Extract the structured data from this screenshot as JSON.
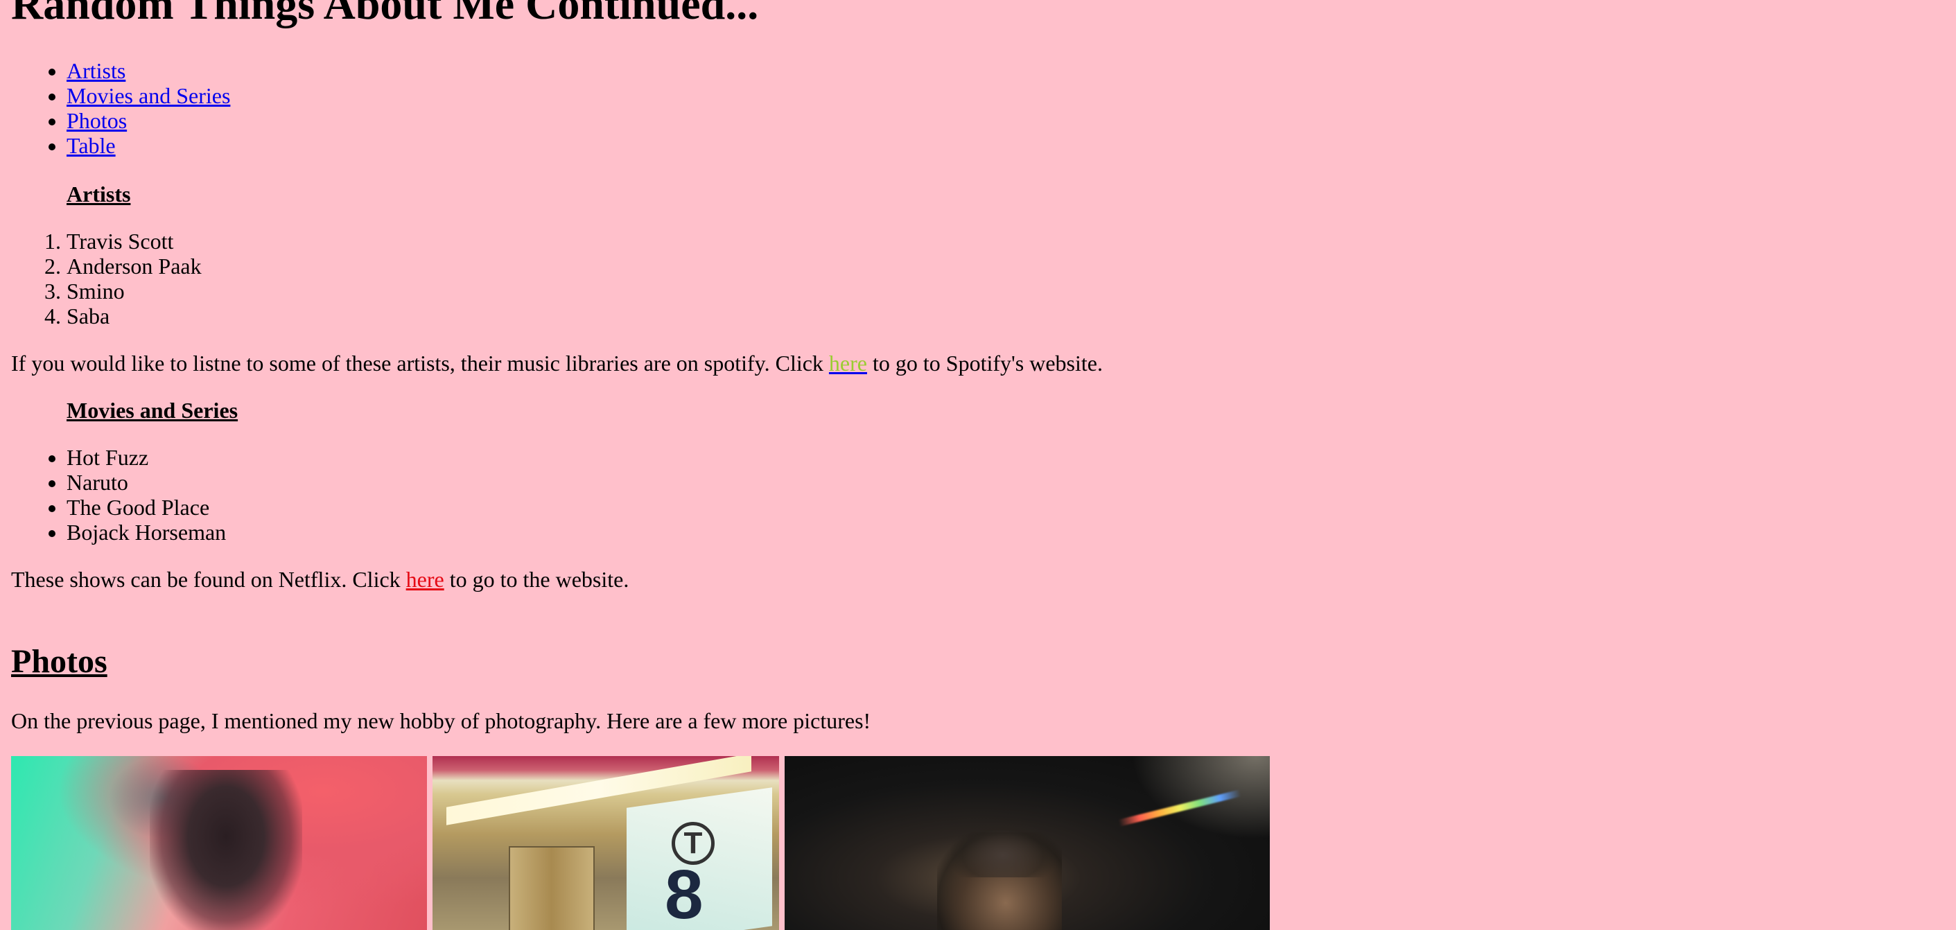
{
  "page": {
    "title": "Random Things About Me Continued..."
  },
  "nav": {
    "items": [
      {
        "label": "Artists"
      },
      {
        "label": "Movies and Series"
      },
      {
        "label": "Photos"
      },
      {
        "label": "Table"
      }
    ]
  },
  "artists": {
    "heading": "Artists",
    "items": [
      "Travis Scott",
      "Anderson Paak",
      "Smino",
      "Saba"
    ],
    "note_before": "If you would like to listne to some of these artists, their music libraries are on spotify. Click ",
    "note_link": "here",
    "note_after": " to go to Spotify's website."
  },
  "movies": {
    "heading": "Movies and Series",
    "items": [
      "Hot Fuzz",
      "Naruto",
      "The Good Place",
      "Bojack Horseman"
    ],
    "note_before": "These shows can be found on Netflix. Click ",
    "note_link": "here",
    "note_after": " to go to the website."
  },
  "photos": {
    "heading": "Photos",
    "intro": "On the previous page, I mentioned my new hobby of photography. Here are a few more pictures!",
    "sign_letter": "T",
    "sign_number": "8"
  },
  "colors": {
    "background": "#ffc0cb",
    "link": "#0000ee",
    "spotify_link": "#9acd32",
    "netflix_link": "#e50914"
  }
}
